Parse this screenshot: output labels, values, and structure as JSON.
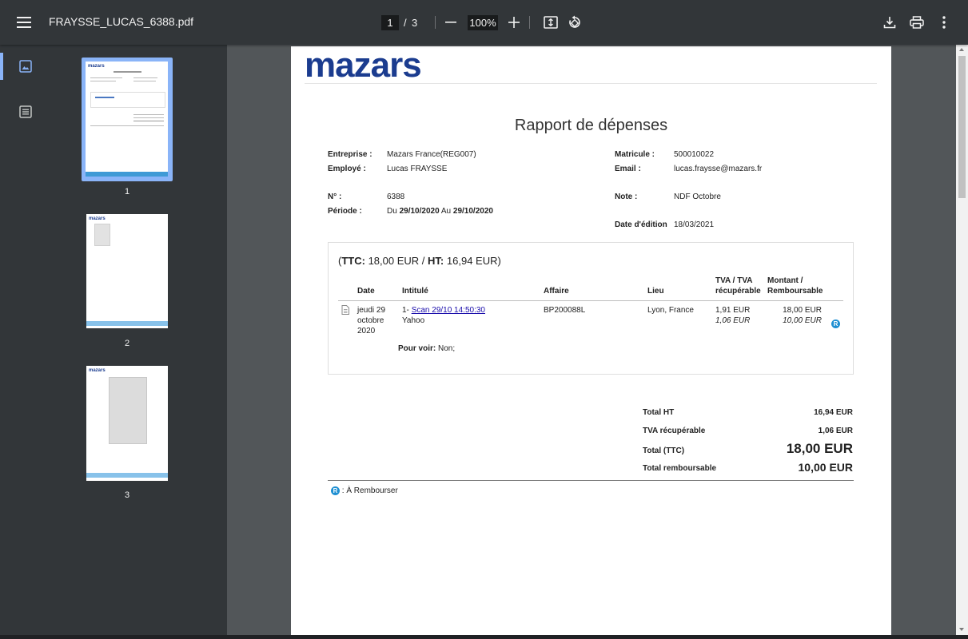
{
  "toolbar": {
    "menu_icon": "hamburger-menu-icon",
    "title": "FRAYSSE_LUCAS_6388.pdf",
    "page_current": "1",
    "page_separator": "/",
    "page_total": "3",
    "zoom": "100%",
    "icons": [
      "zoom-out-icon",
      "zoom-in-icon",
      "fit-page-icon",
      "rotate-icon",
      "download-icon",
      "print-icon",
      "more-vert-icon"
    ]
  },
  "sidebar": {
    "tabs": [
      {
        "name": "thumbnails",
        "icon": "image-icon",
        "active": true
      },
      {
        "name": "outline",
        "icon": "list-icon",
        "active": false
      }
    ],
    "thumbnails": [
      {
        "number": "1",
        "selected": true
      },
      {
        "number": "2",
        "selected": false
      },
      {
        "number": "3",
        "selected": false
      }
    ]
  },
  "report": {
    "logo": "mazars",
    "title": "Rapport de dépenses",
    "fields": {
      "entreprise_label": "Entreprise :",
      "entreprise": "Mazars France(REG007)",
      "employe_label": "Employé :",
      "employe": "Lucas FRAYSSE",
      "numero_label": "N° :",
      "numero": "6388",
      "periode_label": "Période :",
      "periode_du": "Du",
      "periode_start": "29/10/2020",
      "periode_au": "Au",
      "periode_end": "29/10/2020",
      "matricule_label": "Matricule :",
      "matricule": "500010022",
      "email_label": "Email :",
      "email": "lucas.fraysse@mazars.fr",
      "note_label": "Note :",
      "note": "NDF Octobre",
      "date_edition_label": "Date d'édition",
      "date_edition": "18/03/2021"
    },
    "summary": {
      "open": "(",
      "ttc_label": "TTC:",
      "ttc_value": "18,00 EUR",
      "sep": "/",
      "ht_label": "HT:",
      "ht_value": "16,94 EUR",
      "close": ")"
    },
    "table": {
      "headers": {
        "date": "Date",
        "intitule": "Intitulé",
        "affaire": "Affaire",
        "lieu": "Lieu",
        "tva_1": "TVA / TVA",
        "tva_2": "récupérable",
        "montant_1": "Montant /",
        "montant_2": "Remboursable"
      },
      "rows": [
        {
          "icon": "document-icon",
          "date_1": "jeudi 29",
          "date_2": "octobre",
          "date_3": "2020",
          "intitule_prefix": "1-",
          "intitule_link": "Scan 29/10 14:50:30",
          "intitule_2": "Yahoo",
          "affaire": "BP200088L",
          "lieu": "Lyon, France",
          "tva": "1,91 EUR",
          "tva_recuperable": "1,06 EUR",
          "montant": "18,00 EUR",
          "remboursable": "10,00 EUR",
          "badge": "R"
        }
      ],
      "pour_voir_label": "Pour voir:",
      "pour_voir_value": "Non;"
    },
    "totals": {
      "total_ht_label": "Total HT",
      "total_ht": "16,94 EUR",
      "tva_recuperable_label": "TVA récupérable",
      "tva_recuperable": "1,06 EUR",
      "total_ttc_label": "Total (TTC)",
      "total_ttc": "18,00 EUR",
      "total_remboursable_label": "Total remboursable",
      "total_remboursable": "10,00 EUR"
    },
    "legend": {
      "badge": "R",
      "text": ": À Rembourser"
    }
  }
}
